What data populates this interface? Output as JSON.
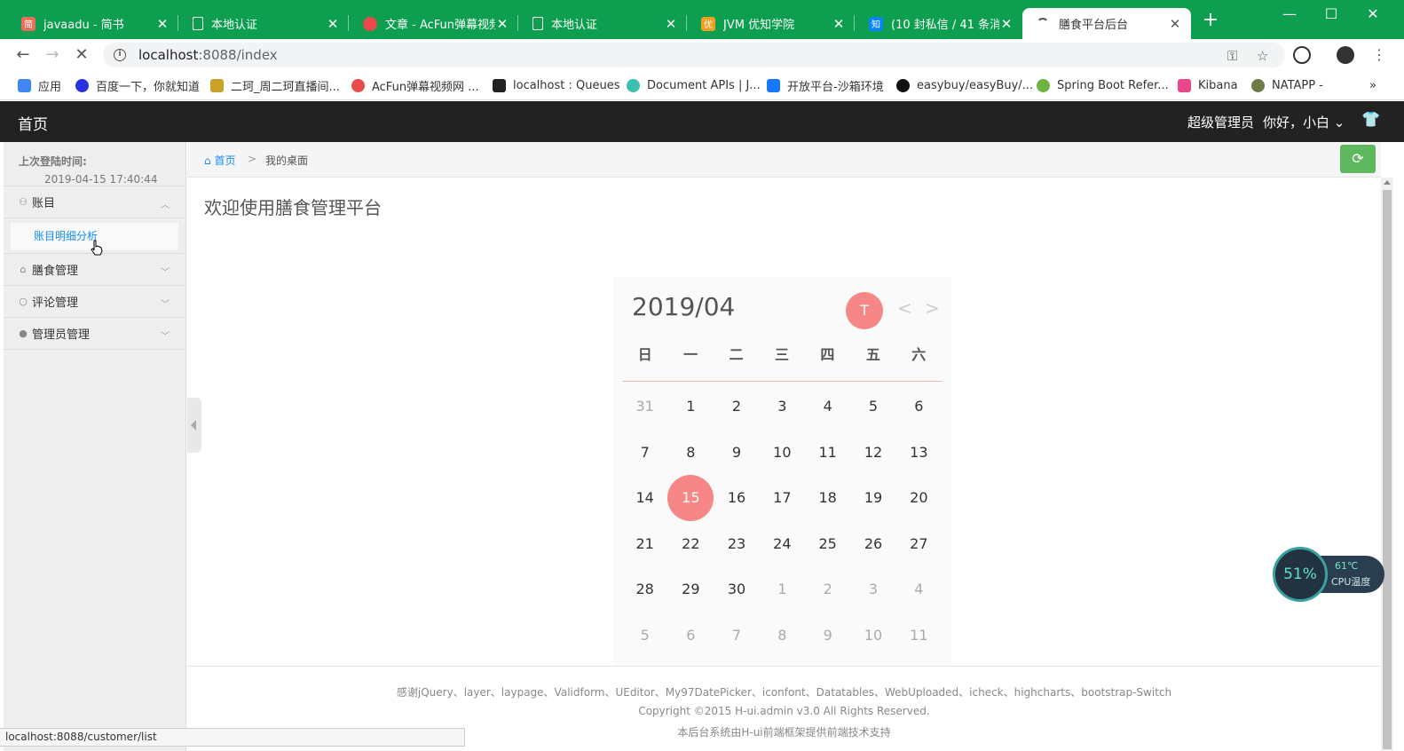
{
  "browser": {
    "tabs": [
      {
        "title": "javaadu - 简书",
        "icon": "jianshu-icon",
        "icon_glyph": "简",
        "icon_color": "#ea6f5a"
      },
      {
        "title": "本地认证",
        "icon": "page-icon",
        "icon_glyph": "",
        "icon_color": ""
      },
      {
        "title": "文章 - AcFun弹幕视频",
        "icon": "acfun-icon",
        "icon_glyph": "",
        "icon_color": "#e94b4b"
      },
      {
        "title": "本地认证",
        "icon": "page-icon",
        "icon_glyph": "",
        "icon_color": ""
      },
      {
        "title": "JVM 优知学院",
        "icon": "youzhi-icon",
        "icon_glyph": "优",
        "icon_color": "#f0a020"
      },
      {
        "title": "(10 封私信 / 41 条消息",
        "icon": "zhihu-icon",
        "icon_glyph": "知",
        "icon_color": "#0a84ff"
      },
      {
        "title": "膳食平台后台",
        "icon": "loading-spinner-icon",
        "icon_glyph": "",
        "icon_color": ""
      }
    ],
    "tab_close": "✕",
    "new_tab": "+",
    "window_controls": {
      "minimize": "—",
      "maximize": "☐",
      "close": "✕"
    },
    "address": {
      "host": "localhost",
      "path": ":8088/index"
    },
    "nav": {
      "back": "←",
      "forward": "→",
      "stop": "✕"
    },
    "bookmarks": [
      {
        "label": "应用",
        "icon": "apps-grid-icon",
        "color": "#4285f4"
      },
      {
        "label": "百度一下，你就知道",
        "icon": "baidu-paw-icon",
        "color": "#2932e1"
      },
      {
        "label": "二珂_周二珂直播间...",
        "icon": "bird-icon",
        "color": "#c9a227"
      },
      {
        "label": "AcFun弹幕视频网 ...",
        "icon": "acfun-icon",
        "color": "#e94b4b"
      },
      {
        "label": "localhost : Queues",
        "icon": "amqp-icon",
        "color": "#222222"
      },
      {
        "label": "Document APIs | J...",
        "icon": "elastic-icon",
        "color": "#3cbeb1"
      },
      {
        "label": "开放平台-沙箱环境",
        "icon": "alipay-icon",
        "color": "#1677ff"
      },
      {
        "label": "easybuy/easyBuy/...",
        "icon": "github-icon",
        "color": "#111111"
      },
      {
        "label": "Spring Boot Refer...",
        "icon": "spring-icon",
        "color": "#6db33f"
      },
      {
        "label": "Kibana",
        "icon": "kibana-icon",
        "color": "#e8478b"
      },
      {
        "label": "NATAPP -",
        "icon": "natapp-icon",
        "color": "#6a7b45"
      }
    ],
    "bookmarks_more": "»",
    "status_url": "localhost:8088/customer/list"
  },
  "header": {
    "logo": "首页",
    "role": "超级管理员",
    "greeting": "你好，小白",
    "dropdown": "⌄",
    "skin_icon": "👕"
  },
  "sidebar": {
    "last_login_label": "上次登陆时间:",
    "last_login_value": "2019-04-15 17:40:44",
    "menus": [
      {
        "label": "账目",
        "icon": "user-outline-icon",
        "expanded": true,
        "sub": [
          "账目明细分析"
        ]
      },
      {
        "label": "膳食管理",
        "icon": "bag-icon",
        "expanded": false
      },
      {
        "label": "评论管理",
        "icon": "comment-icon",
        "expanded": false
      },
      {
        "label": "管理员管理",
        "icon": "user-solid-icon",
        "expanded": false
      }
    ]
  },
  "breadcrumb": {
    "home": "首页",
    "separator": ">",
    "current": "我的桌面"
  },
  "refresh_icon": "⟳",
  "welcome": "欢迎使用膳食管理平台",
  "calendar": {
    "year_month": "2019/04",
    "today_badge": "T",
    "prev": "<",
    "next": ">",
    "weekdays": [
      "日",
      "一",
      "二",
      "三",
      "四",
      "五",
      "六"
    ],
    "days": [
      {
        "d": "31",
        "other": true
      },
      {
        "d": "1"
      },
      {
        "d": "2"
      },
      {
        "d": "3"
      },
      {
        "d": "4"
      },
      {
        "d": "5"
      },
      {
        "d": "6"
      },
      {
        "d": "7"
      },
      {
        "d": "8"
      },
      {
        "d": "9"
      },
      {
        "d": "10"
      },
      {
        "d": "11"
      },
      {
        "d": "12"
      },
      {
        "d": "13"
      },
      {
        "d": "14"
      },
      {
        "d": "15",
        "today": true
      },
      {
        "d": "16"
      },
      {
        "d": "17"
      },
      {
        "d": "18"
      },
      {
        "d": "19"
      },
      {
        "d": "20"
      },
      {
        "d": "21"
      },
      {
        "d": "22"
      },
      {
        "d": "23"
      },
      {
        "d": "24"
      },
      {
        "d": "25"
      },
      {
        "d": "26"
      },
      {
        "d": "27"
      },
      {
        "d": "28"
      },
      {
        "d": "29"
      },
      {
        "d": "30"
      },
      {
        "d": "1",
        "other": true
      },
      {
        "d": "2",
        "other": true
      },
      {
        "d": "3",
        "other": true
      },
      {
        "d": "4",
        "other": true
      },
      {
        "d": "5",
        "other": true
      },
      {
        "d": "6",
        "other": true
      },
      {
        "d": "7",
        "other": true
      },
      {
        "d": "8",
        "other": true
      },
      {
        "d": "9",
        "other": true
      },
      {
        "d": "10",
        "other": true
      },
      {
        "d": "11",
        "other": true
      }
    ]
  },
  "footer": {
    "line1": "感谢jQuery、layer、laypage、Validform、UEditor、My97DatePicker、iconfont、Datatables、WebUploaded、icheck、highcharts、bootstrap-Switch",
    "line2": "Copyright ©2015 H-ui.admin v3.0 All Rights Reserved.",
    "line3": "本后台系统由H-ui前端框架提供前端技术支持"
  },
  "cpu_widget": {
    "percent": "51%",
    "temperature": "61℃",
    "label": "CPU温度"
  }
}
